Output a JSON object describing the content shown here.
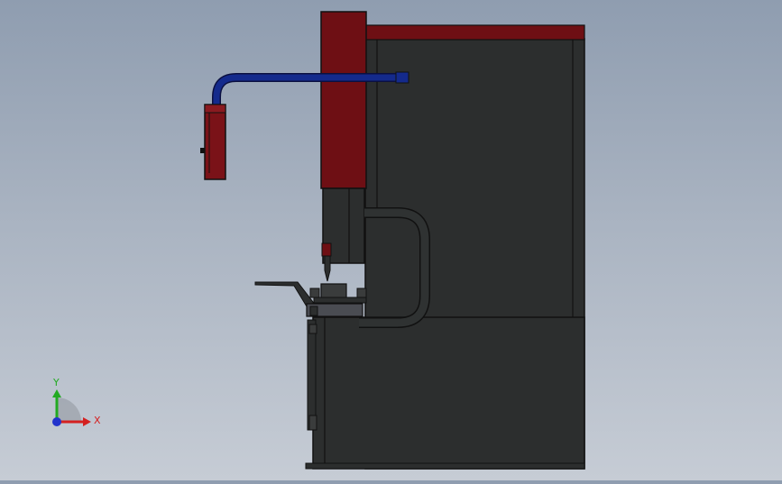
{
  "viewport": {
    "colors": {
      "background_top": "#8f9db0",
      "background_bottom": "#c6ccd5",
      "frame": "#2c2e2e",
      "frame_edge": "#111111",
      "ram": "#6e0f14",
      "arm": "#142a8c",
      "pendant": "#7a1218",
      "hose": "#2a2c2c"
    }
  },
  "triad": {
    "x_label": "X",
    "y_label": "Y",
    "x_color": "#d42020",
    "y_color": "#22aa22",
    "z_color": "#2233cc"
  }
}
